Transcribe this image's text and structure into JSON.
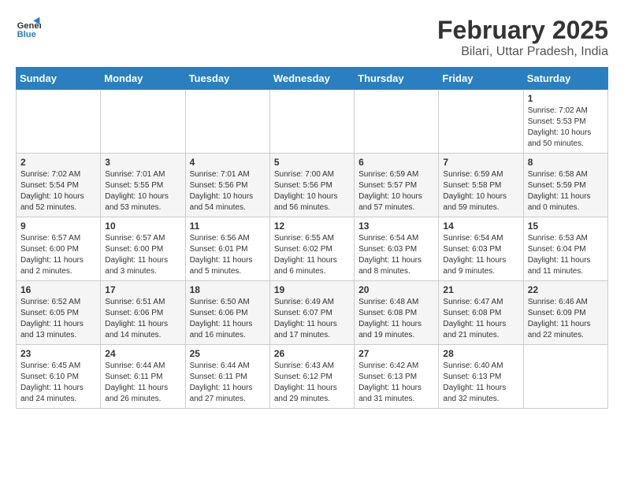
{
  "header": {
    "logo_general": "General",
    "logo_blue": "Blue",
    "month_title": "February 2025",
    "location": "Bilari, Uttar Pradesh, India"
  },
  "weekdays": [
    "Sunday",
    "Monday",
    "Tuesday",
    "Wednesday",
    "Thursday",
    "Friday",
    "Saturday"
  ],
  "weeks": [
    [
      {
        "day": "",
        "info": ""
      },
      {
        "day": "",
        "info": ""
      },
      {
        "day": "",
        "info": ""
      },
      {
        "day": "",
        "info": ""
      },
      {
        "day": "",
        "info": ""
      },
      {
        "day": "",
        "info": ""
      },
      {
        "day": "1",
        "info": "Sunrise: 7:02 AM\nSunset: 5:53 PM\nDaylight: 10 hours\nand 50 minutes."
      }
    ],
    [
      {
        "day": "2",
        "info": "Sunrise: 7:02 AM\nSunset: 5:54 PM\nDaylight: 10 hours\nand 52 minutes."
      },
      {
        "day": "3",
        "info": "Sunrise: 7:01 AM\nSunset: 5:55 PM\nDaylight: 10 hours\nand 53 minutes."
      },
      {
        "day": "4",
        "info": "Sunrise: 7:01 AM\nSunset: 5:56 PM\nDaylight: 10 hours\nand 54 minutes."
      },
      {
        "day": "5",
        "info": "Sunrise: 7:00 AM\nSunset: 5:56 PM\nDaylight: 10 hours\nand 56 minutes."
      },
      {
        "day": "6",
        "info": "Sunrise: 6:59 AM\nSunset: 5:57 PM\nDaylight: 10 hours\nand 57 minutes."
      },
      {
        "day": "7",
        "info": "Sunrise: 6:59 AM\nSunset: 5:58 PM\nDaylight: 10 hours\nand 59 minutes."
      },
      {
        "day": "8",
        "info": "Sunrise: 6:58 AM\nSunset: 5:59 PM\nDaylight: 11 hours\nand 0 minutes."
      }
    ],
    [
      {
        "day": "9",
        "info": "Sunrise: 6:57 AM\nSunset: 6:00 PM\nDaylight: 11 hours\nand 2 minutes."
      },
      {
        "day": "10",
        "info": "Sunrise: 6:57 AM\nSunset: 6:00 PM\nDaylight: 11 hours\nand 3 minutes."
      },
      {
        "day": "11",
        "info": "Sunrise: 6:56 AM\nSunset: 6:01 PM\nDaylight: 11 hours\nand 5 minutes."
      },
      {
        "day": "12",
        "info": "Sunrise: 6:55 AM\nSunset: 6:02 PM\nDaylight: 11 hours\nand 6 minutes."
      },
      {
        "day": "13",
        "info": "Sunrise: 6:54 AM\nSunset: 6:03 PM\nDaylight: 11 hours\nand 8 minutes."
      },
      {
        "day": "14",
        "info": "Sunrise: 6:54 AM\nSunset: 6:03 PM\nDaylight: 11 hours\nand 9 minutes."
      },
      {
        "day": "15",
        "info": "Sunrise: 6:53 AM\nSunset: 6:04 PM\nDaylight: 11 hours\nand 11 minutes."
      }
    ],
    [
      {
        "day": "16",
        "info": "Sunrise: 6:52 AM\nSunset: 6:05 PM\nDaylight: 11 hours\nand 13 minutes."
      },
      {
        "day": "17",
        "info": "Sunrise: 6:51 AM\nSunset: 6:06 PM\nDaylight: 11 hours\nand 14 minutes."
      },
      {
        "day": "18",
        "info": "Sunrise: 6:50 AM\nSunset: 6:06 PM\nDaylight: 11 hours\nand 16 minutes."
      },
      {
        "day": "19",
        "info": "Sunrise: 6:49 AM\nSunset: 6:07 PM\nDaylight: 11 hours\nand 17 minutes."
      },
      {
        "day": "20",
        "info": "Sunrise: 6:48 AM\nSunset: 6:08 PM\nDaylight: 11 hours\nand 19 minutes."
      },
      {
        "day": "21",
        "info": "Sunrise: 6:47 AM\nSunset: 6:08 PM\nDaylight: 11 hours\nand 21 minutes."
      },
      {
        "day": "22",
        "info": "Sunrise: 6:46 AM\nSunset: 6:09 PM\nDaylight: 11 hours\nand 22 minutes."
      }
    ],
    [
      {
        "day": "23",
        "info": "Sunrise: 6:45 AM\nSunset: 6:10 PM\nDaylight: 11 hours\nand 24 minutes."
      },
      {
        "day": "24",
        "info": "Sunrise: 6:44 AM\nSunset: 6:11 PM\nDaylight: 11 hours\nand 26 minutes."
      },
      {
        "day": "25",
        "info": "Sunrise: 6:44 AM\nSunset: 6:11 PM\nDaylight: 11 hours\nand 27 minutes."
      },
      {
        "day": "26",
        "info": "Sunrise: 6:43 AM\nSunset: 6:12 PM\nDaylight: 11 hours\nand 29 minutes."
      },
      {
        "day": "27",
        "info": "Sunrise: 6:42 AM\nSunset: 6:13 PM\nDaylight: 11 hours\nand 31 minutes."
      },
      {
        "day": "28",
        "info": "Sunrise: 6:40 AM\nSunset: 6:13 PM\nDaylight: 11 hours\nand 32 minutes."
      },
      {
        "day": "",
        "info": ""
      }
    ]
  ]
}
